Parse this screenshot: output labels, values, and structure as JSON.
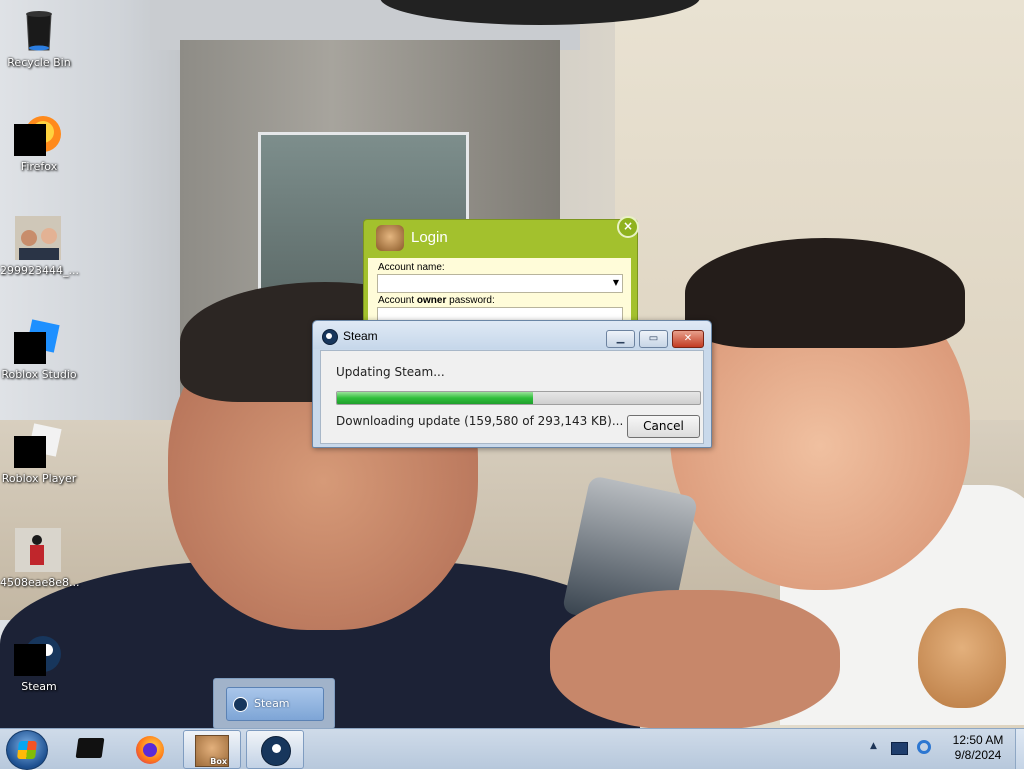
{
  "desktop": {
    "icons": [
      {
        "label": "Recycle Bin",
        "icon": "recycle-bin-icon"
      },
      {
        "label": "Firefox",
        "icon": "firefox-icon"
      },
      {
        "label": "299923444_...",
        "icon": "photo-thumbnail-icon"
      },
      {
        "label": "Roblox Studio",
        "icon": "roblox-studio-icon"
      },
      {
        "label": "Roblox Player",
        "icon": "roblox-player-icon"
      },
      {
        "label": "4508eae8e8...",
        "icon": "photo-thumbnail-icon"
      },
      {
        "label": "Steam",
        "icon": "steam-icon"
      }
    ]
  },
  "login_window": {
    "title": "Login",
    "account_name_label": "Account name:",
    "account_name_value": "",
    "password_label_pre": "Account ",
    "password_label_bold": "owner",
    "password_label_post": " password:",
    "accent_color": "#a3c12d"
  },
  "steam_dialog": {
    "title": "Steam",
    "status": "Updating Steam...",
    "progress_fraction": 0.54,
    "download_text": "Downloading update (159,580 of 293,143 KB)...",
    "cancel_label": "Cancel",
    "progress_color": "#2fbf3b"
  },
  "taskbar_thumbnail": {
    "label": "Steam"
  },
  "taskbar": {
    "pinned": [
      {
        "name": "start-button"
      },
      {
        "name": "monitor-app",
        "icon": "monitor-icon"
      },
      {
        "name": "firefox",
        "icon": "firefox-icon"
      },
      {
        "name": "box-app",
        "icon": "hamster-box-icon",
        "badge": "Box"
      },
      {
        "name": "steam",
        "icon": "steam-icon"
      }
    ],
    "clock_time": "12:50 AM",
    "clock_date": "9/8/2024"
  }
}
